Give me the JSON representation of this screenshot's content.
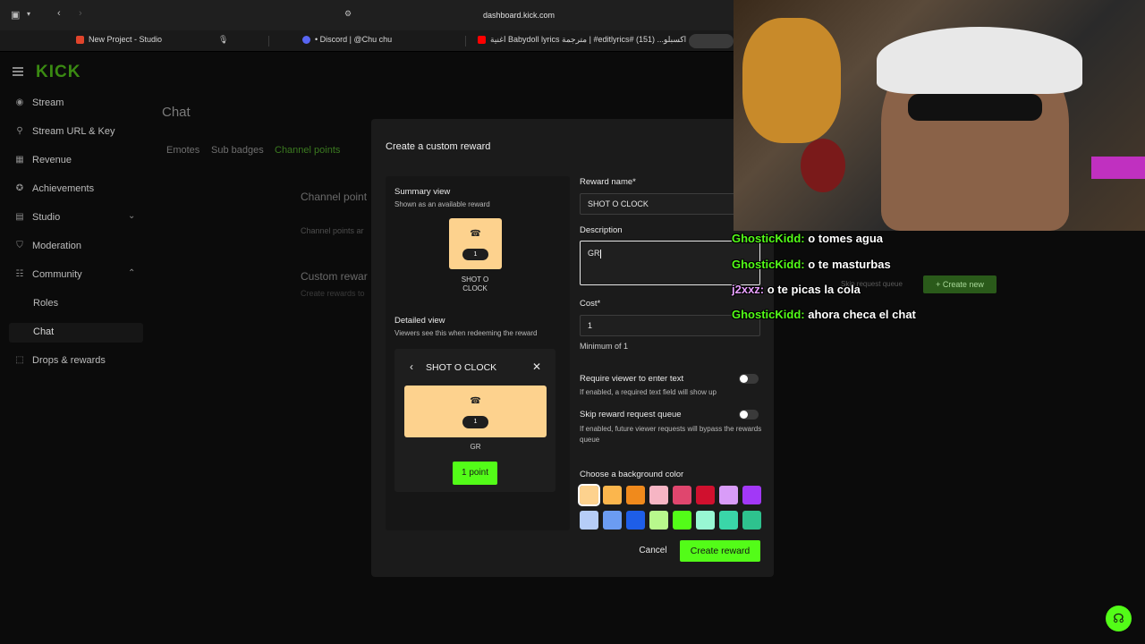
{
  "browser": {
    "url": "dashboard.kick.com",
    "tabs": [
      {
        "label": "New Project - Studio",
        "color": "#e0442b"
      },
      {
        "label": "• Discord | @Chu chu",
        "color": "#5865f2"
      },
      {
        "label": "اغنية Babydoll lyrics مترجمة | #editlyrics# اكسبلو... (151)",
        "color": "#ff0000"
      }
    ]
  },
  "brand": {
    "logo": "KICK",
    "accent": "#53fc18"
  },
  "sidebar": {
    "items": [
      {
        "label": "Stream",
        "icon": "broadcast-icon"
      },
      {
        "label": "Stream URL & Key",
        "icon": "key-icon"
      },
      {
        "label": "Revenue",
        "icon": "revenue-icon"
      },
      {
        "label": "Achievements",
        "icon": "trophy-icon"
      },
      {
        "label": "Studio",
        "icon": "studio-icon"
      },
      {
        "label": "Moderation",
        "icon": "shield-icon"
      },
      {
        "label": "Community",
        "icon": "people-icon"
      },
      {
        "label": "Drops & rewards",
        "icon": "gift-icon"
      }
    ],
    "sub_items": [
      "Roles",
      "Chat"
    ]
  },
  "page": {
    "title": "Chat",
    "tabs": [
      "Emotes",
      "Sub badges",
      "Channel points"
    ],
    "section1_title": "Channel point",
    "section1_sub": "Channel points ar",
    "section2_title": "Custom rewar",
    "section2_sub": "Create rewards to",
    "skip_queue_label": "Skip request queue",
    "create_new_label": "+ Create new"
  },
  "modal": {
    "title": "Create a custom reward",
    "summary_view": {
      "title": "Summary view",
      "subtitle": "Shown as an available reward",
      "tile_cost": "1",
      "tile_name": "SHOT O CLOCK"
    },
    "detailed_view": {
      "title": "Detailed view",
      "subtitle": "Viewers see this when redeeming the reward",
      "header": "SHOT O CLOCK",
      "cost": "1",
      "description": "GR",
      "points_button": "1 point"
    },
    "reward_name": {
      "label": "Reward name*",
      "value": "SHOT O CLOCK"
    },
    "description": {
      "label": "Description",
      "value": "GR"
    },
    "cost": {
      "label": "Cost*",
      "value": "1",
      "hint": "Minimum of 1"
    },
    "require_text": {
      "label": "Require viewer to enter text",
      "hint": "If enabled, a required text field will show up",
      "enabled": false
    },
    "skip_queue": {
      "label": "Skip reward request queue",
      "hint": "If enabled, future viewer requests will bypass the rewards queue",
      "enabled": false
    },
    "bg_color": {
      "label": "Choose a background color",
      "selected": "#fdd28e",
      "colors_row1": [
        "#fdd28e",
        "#fbb64d",
        "#f08a1c",
        "#f6b5c4",
        "#e0466e",
        "#d0102e",
        "#d99cf8",
        "#a238f7"
      ],
      "colors_row2": [
        "#b6cdf7",
        "#6b9cf2",
        "#1e5ee8",
        "#b8f88c",
        "#53fc18",
        "#98f7d3",
        "#3ad6a8",
        "#2ec28e"
      ]
    },
    "cancel_label": "Cancel",
    "create_label": "Create reward"
  },
  "stream_chat": [
    {
      "user": "GhosticKidd:",
      "text": " o tomes agua"
    },
    {
      "user": "GhosticKidd:",
      "text": " o te masturbas"
    },
    {
      "user": "j2xxz:",
      "text": " o te picas la cola"
    },
    {
      "user": "GhosticKidd:",
      "text": " ahora checa el chat"
    }
  ]
}
